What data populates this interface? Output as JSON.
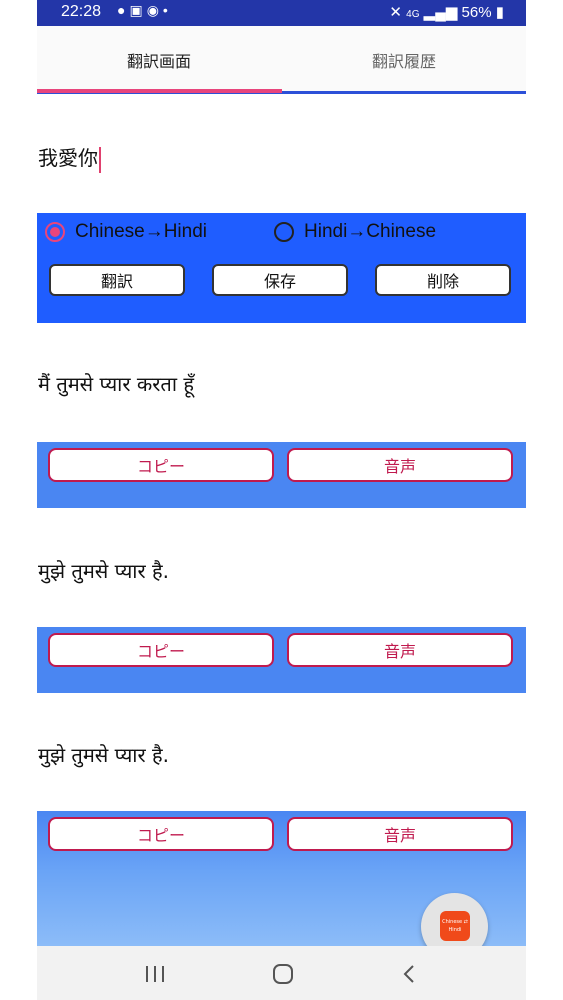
{
  "status_bar": {
    "time": "22:28",
    "notification_icons": [
      "line-icon",
      "image-icon",
      "messenger-icon",
      "dot-icon"
    ],
    "network": "4G",
    "battery": "56%"
  },
  "tabs": [
    {
      "label": "翻訳画面",
      "active": true
    },
    {
      "label": "翻訳履歴",
      "active": false
    }
  ],
  "input": {
    "value": "我愛你"
  },
  "controls": {
    "radio_options": [
      {
        "label": "Chinese→Hindi",
        "selected": true
      },
      {
        "label": "Hindi→Chinese",
        "selected": false
      }
    ],
    "buttons": {
      "translate": "翻訳",
      "save": "保存",
      "delete": "削除"
    }
  },
  "results": [
    {
      "text": "मैं तुमसे प्यार करता हूँ",
      "copy_label": "コピー",
      "voice_label": "音声"
    },
    {
      "text": "मुझे तुमसे प्यार है.",
      "copy_label": "コピー",
      "voice_label": "音声"
    },
    {
      "text": "मुझे तुमसे प्यार है.",
      "copy_label": "コピー",
      "voice_label": "音声"
    }
  ],
  "fab": {
    "icon": "app-logo-icon",
    "label": "Chinese ⇄ Hindi"
  },
  "colors": {
    "status_bar": "#2336a8",
    "accent_pink": "#e8457c",
    "tab_underline": "#2c50d8",
    "control_panel": "#1f5dff",
    "result_band": "#4a86f2",
    "button_border_red": "#c01a4e",
    "fab_icon": "#f04a1a"
  }
}
